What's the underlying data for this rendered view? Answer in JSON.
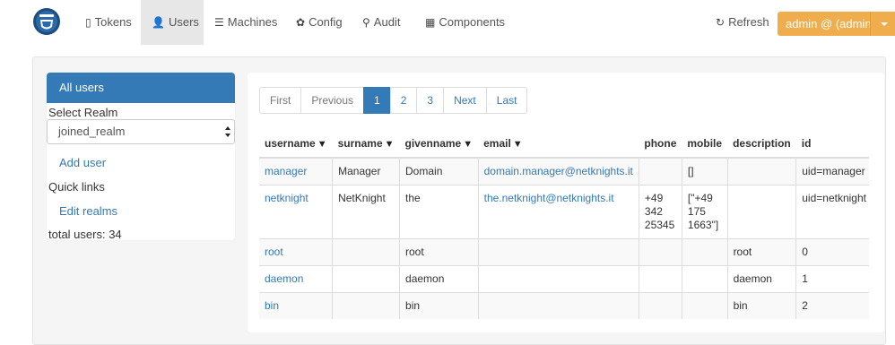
{
  "nav": {
    "items": [
      {
        "label": "Tokens",
        "icon": "tablet-icon"
      },
      {
        "label": "Users",
        "icon": "user-icon"
      },
      {
        "label": "Machines",
        "icon": "server-icon"
      },
      {
        "label": "Config",
        "icon": "gear-icon"
      },
      {
        "label": "Audit",
        "icon": "search-icon"
      },
      {
        "label": "Components",
        "icon": "list-icon"
      }
    ],
    "active": "Users",
    "refresh_label": "Refresh",
    "admin_label": "admin @ (admin)",
    "accent_color": "#f0ad4e"
  },
  "sidebar": {
    "all_users": "All users",
    "select_realm": "Select Realm",
    "realm_value": "joined_realm",
    "add_user": "Add user",
    "quick_links": "Quick links",
    "edit_realms": "Edit realms",
    "total_users": "total users: 34"
  },
  "pagination": {
    "first": "First",
    "previous": "Previous",
    "pages": [
      "1",
      "2",
      "3"
    ],
    "current": "1",
    "next": "Next",
    "last": "Last"
  },
  "table": {
    "headers": [
      "username",
      "surname",
      "givenname",
      "email",
      "phone",
      "mobile",
      "description",
      "id"
    ],
    "rows": [
      {
        "username": "manager",
        "surname": "Manager",
        "givenname": "Domain",
        "email": "domain.manager@netknights.it",
        "phone": "",
        "mobile": "[]",
        "description": "",
        "id": "uid=manager"
      },
      {
        "username": "netknight",
        "surname": "NetKnight",
        "givenname": "the",
        "email": "the.netknight@netknights.it",
        "phone": "+49\n342\n25345",
        "mobile": "[\"+49\n175\n1663\"]",
        "description": "",
        "id": "uid=netknight"
      },
      {
        "username": "root",
        "surname": "",
        "givenname": "root",
        "email": "",
        "phone": "",
        "mobile": "",
        "description": "root",
        "id": "0"
      },
      {
        "username": "daemon",
        "surname": "",
        "givenname": "daemon",
        "email": "",
        "phone": "",
        "mobile": "",
        "description": "daemon",
        "id": "1"
      },
      {
        "username": "bin",
        "surname": "",
        "givenname": "bin",
        "email": "",
        "phone": "",
        "mobile": "",
        "description": "bin",
        "id": "2"
      }
    ]
  }
}
